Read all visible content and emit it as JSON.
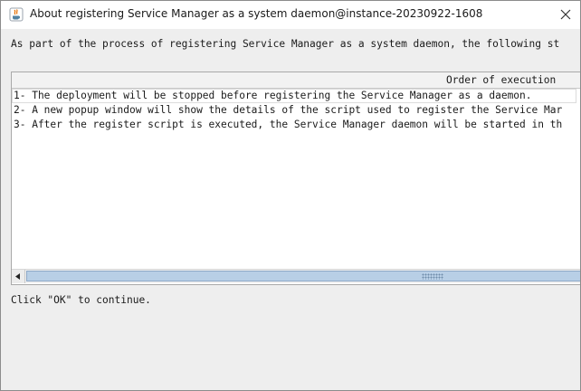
{
  "window": {
    "title": "About registering Service Manager as a system daemon@instance-20230922-1608",
    "icon": "java-icon",
    "close_icon": "close-icon"
  },
  "intro": {
    "text": "As part of the process of registering Service Manager as a system daemon, the following st"
  },
  "table": {
    "column_header": "Order of execution",
    "rows": [
      "1- The deployment will be stopped before registering the Service Manager as a daemon.",
      "2- A new popup window will show the details of the script used to register the Service Mar",
      "3- After the register script is executed, the Service Manager daemon will be started in th"
    ]
  },
  "footer": {
    "text": "Click \"OK\" to continue."
  },
  "colors": {
    "scroll_thumb": "#b8cfe6",
    "window_bg": "#eeeeee",
    "table_bg": "#ffffff"
  }
}
